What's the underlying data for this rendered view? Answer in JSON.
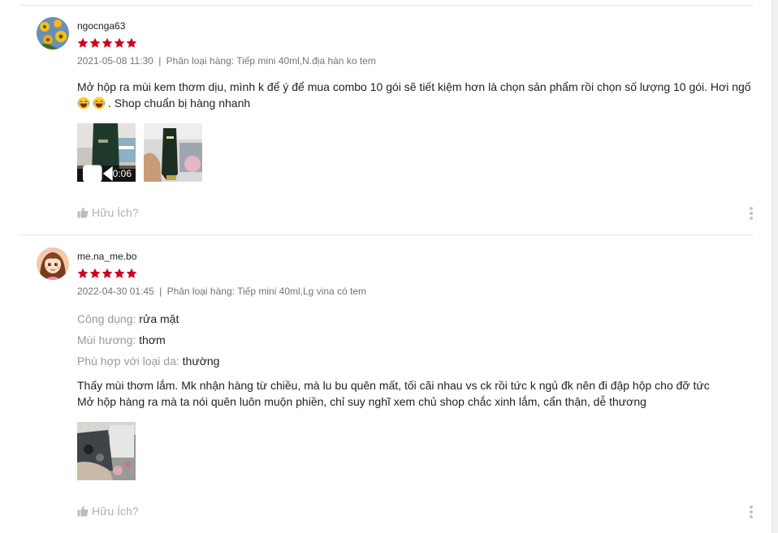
{
  "colors": {
    "star": "#d0011b",
    "meta": "#757575",
    "attr_key": "#999999",
    "helpful": "#b0b0b0",
    "divider": "#e8e8e8"
  },
  "reviews": [
    {
      "username": "ngocnga63",
      "rating": 5,
      "datetime": "2021-05-08 11:30",
      "separator": "|",
      "variant_label": "Phân loại hàng:",
      "variant_value": "Tiếp mini 40ml,N.địa hàn ko tem",
      "text_before_emoji": "Mở hộp ra mùi kem thơm dịu, mình k để ý để mua combo 10 gói sẽ tiết kiệm hơn là chọn sản phẩm rồi chọn số lượng 10 gói. Hơi ngố",
      "emoji_icon": "laughing-face-icon",
      "text_after_emoji": ". Shop chuẩn bị hàng nhanh",
      "media": [
        {
          "kind": "video",
          "duration": "0:06",
          "icon": "video-camera-icon"
        },
        {
          "kind": "image"
        }
      ],
      "helpful_label": "Hữu Ích?"
    },
    {
      "username": "me.na_me.bo",
      "rating": 5,
      "datetime": "2022-04-30 01:45",
      "separator": "|",
      "variant_label": "Phân loại hàng:",
      "variant_value": "Tiếp mini 40ml,Lg vina có tem",
      "attributes": [
        {
          "key": "Công dụng:",
          "value": "rửa mặt"
        },
        {
          "key": "Mùi hương:",
          "value": "thơm"
        },
        {
          "key": "Phù hợp với loại da:",
          "value": "thường"
        }
      ],
      "text_line1": "Thấy mùi thơm lắm. Mk nhận hàng từ chiều, mà lu bu quên mất, tối cãi nhau vs ck rồi tức k ngủ đk nên đi đập hộp cho đỡ tức",
      "text_line2": "Mở hộp hàng ra mà ta nói quên luôn muộn phiền, chỉ suy nghĩ xem chủ shop chắc xinh lắm, cẩn thận, dễ thương",
      "media": [
        {
          "kind": "image"
        }
      ],
      "helpful_label": "Hữu Ích?"
    }
  ]
}
